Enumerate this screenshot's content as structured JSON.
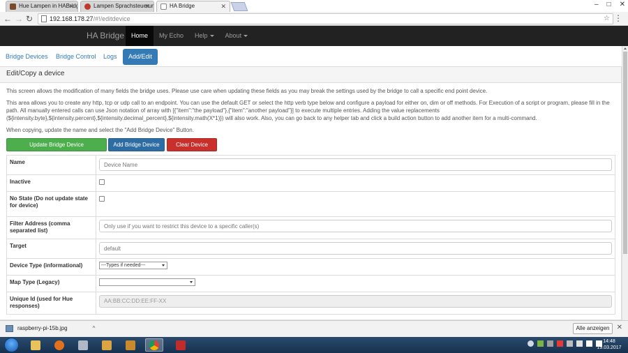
{
  "browser": {
    "tabs": [
      {
        "title": "Hue Lampen in HABridg",
        "favicon_color": "#7a4b2a"
      },
      {
        "title": "Lampen Sprachsteuerun",
        "favicon_color": "#c0392b"
      },
      {
        "title": "HA Bridge",
        "favicon_color": "#ffffff"
      }
    ],
    "url_host": "192.168.178.27",
    "url_path": "/#!/editdevice"
  },
  "app": {
    "brand": "HA Bridge",
    "nav": {
      "home": "Home",
      "my_echo": "My Echo",
      "help": "Help",
      "about": "About"
    },
    "pills": {
      "bridge_devices": "Bridge Devices",
      "bridge_control": "Bridge Control",
      "logs": "Logs",
      "add_edit": "Add/Edit"
    }
  },
  "panel": {
    "title": "Edit/Copy a device",
    "intro1": "This screen allows the modification of many fields the bridge uses. Please use care when updating these fields as you may break the settings used by the bridge to call a specific end point device.",
    "intro2": "This area allows you to create any http, tcp or udp call to an endpoint. You can use the default GET or select the http verb type below and configure a payload for either on, dim or off methods. For Execution of a script or program, please fill in the path. All manually entered calls can use Json notation of array with [{\"item\":\"the payload\"},{\"item\":\"another payload\"}] to execute multiple entries. Adding the value replacements (${intensity.byte},${intensity.percent},${intensity.decimal_percent},${intensity.math(X*1)}) will also work. Also, you can go back to any helper tab and click a build action button to add another item for a multi-command.",
    "intro3": "When copying, update the name and select the \"Add Bridge Device\" Button.",
    "buttons": {
      "update": "Update Bridge Device",
      "add": "Add Bridge Device",
      "clear": "Clear Device"
    },
    "fields": {
      "name_label": "Name",
      "name_placeholder": "Device Name",
      "inactive_label": "Inactive",
      "nostate_label": "No State (Do not update state for device)",
      "filter_label": "Filter Address (comma separated list)",
      "filter_placeholder": "Only use if you want to restrict this device to a specific caller(s)",
      "target_label": "Target",
      "target_placeholder": "default",
      "devtype_label": "Device Type (informational)",
      "devtype_value": "---Types if needed---",
      "maptype_label": "Map Type (Legacy)",
      "maptype_value": "",
      "uniqueid_label": "Unique Id (used for Hue responses)",
      "uniqueid_value": "AA:BB:CC:DD:EE:FF-XX"
    }
  },
  "downloads": {
    "file": "raspberry-pi-15b.jpg",
    "show_all": "Alle anzeigen"
  },
  "taskbar": {
    "time": "14:48",
    "date": "19.03.2017"
  },
  "colors": {
    "navbar": "#222222",
    "primary": "#337ab7",
    "success": "#5cb85c",
    "danger": "#d9534f"
  }
}
